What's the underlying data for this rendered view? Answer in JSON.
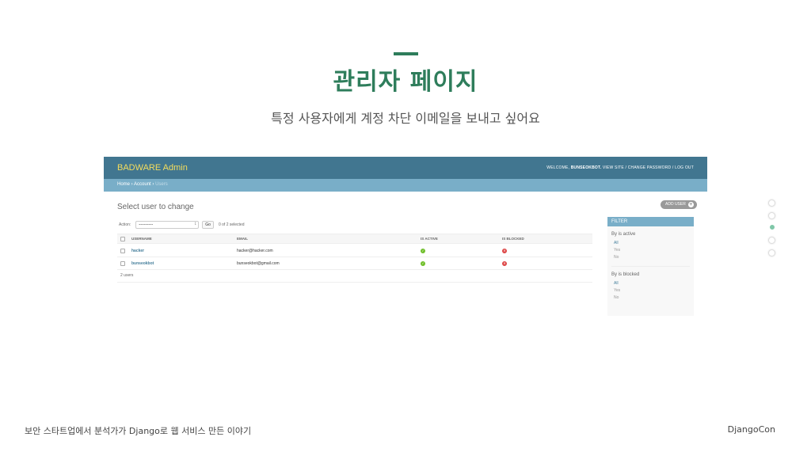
{
  "slide": {
    "title": "관리자 페이지",
    "subtitle": "특정 사용자에게 계정 차단 이메일을 보내고 싶어요",
    "footer_left": "보안 스타트업에서 분석가가 Django로 웹 서비스 만든 이야기",
    "footer_right": "DjangoCon",
    "accent_color": "#2e7d5b",
    "nav_dots": 5,
    "active_dot": 3
  },
  "admin": {
    "brand": "BADWARE Admin",
    "user_tools": {
      "welcome": "WELCOME,",
      "username": "BUNSEOKBOT.",
      "links": "VIEW SITE / CHANGE PASSWORD / LOG OUT"
    },
    "breadcrumbs": {
      "home": "Home",
      "sep": " › ",
      "app": "Account",
      "current": "Users"
    },
    "page_heading": "Select user to change",
    "add_button": "ADD USER",
    "actions": {
      "label": "Action:",
      "select_value": "---------",
      "go": "Go",
      "counter": "0 of 2 selected"
    },
    "table": {
      "headers": [
        "USERNAME",
        "EMAIL",
        "IS ACTIVE",
        "IS BLOCKED"
      ],
      "rows": [
        {
          "username": "hacker",
          "email": "hacker@hacker.com",
          "is_active": "yes",
          "is_blocked": "no"
        },
        {
          "username": "bunseokbot",
          "email": "bunseokbot@gmail.com",
          "is_active": "yes",
          "is_blocked": "no"
        }
      ]
    },
    "paginator": "2 users",
    "filter": {
      "title": "FILTER",
      "groups": [
        {
          "title": "By is active",
          "options": [
            "All",
            "Yes",
            "No"
          ],
          "selected": "All"
        },
        {
          "title": "By is blocked",
          "options": [
            "All",
            "Yes",
            "No"
          ],
          "selected": "All"
        }
      ]
    },
    "colors": {
      "header_bg": "#417690",
      "brand": "#f5dd5d",
      "breadcrumb_bg": "#79aec8",
      "link": "#447e9b",
      "active_icon": "#70bf2b",
      "blocked_icon": "#dd4646"
    }
  }
}
